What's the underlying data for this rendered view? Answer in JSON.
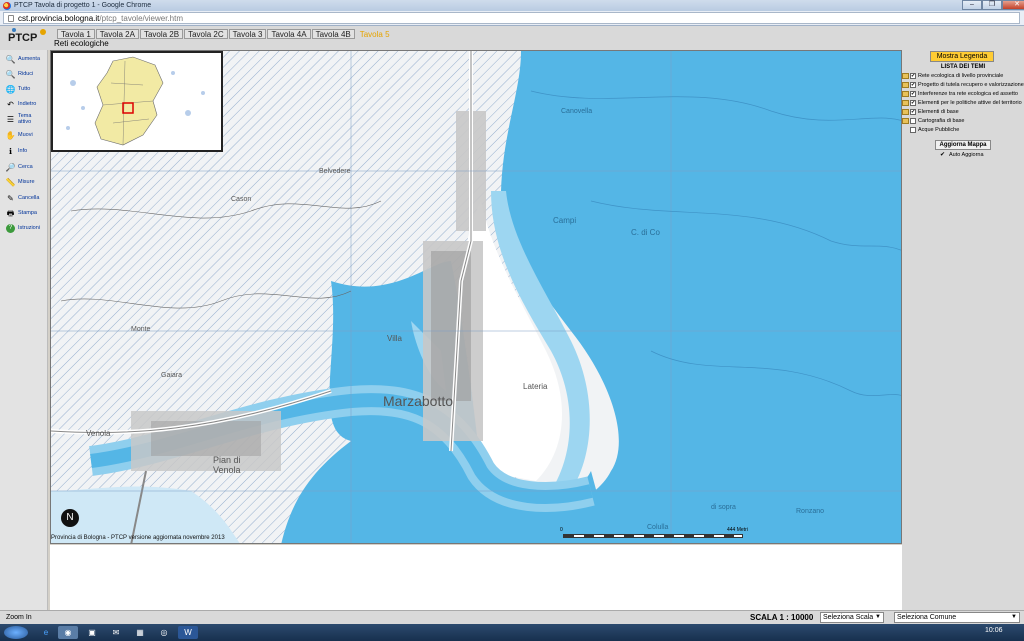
{
  "window": {
    "title": "PTCP Tavola di progetto 1 - Google Chrome",
    "controls": [
      "–",
      "❐",
      "✕"
    ]
  },
  "address": {
    "host": "cst.provincia.bologna.it",
    "path": "/ptcp_tavole/viewer.htm"
  },
  "app": {
    "logo_text": "PTCP",
    "tabs": [
      {
        "label": "Tavola 1"
      },
      {
        "label": "Tavola 2A"
      },
      {
        "label": "Tavola 2B"
      },
      {
        "label": "Tavola 2C"
      },
      {
        "label": "Tavola 3"
      },
      {
        "label": "Tavola 4A"
      },
      {
        "label": "Tavola 4B"
      },
      {
        "label": "Tavola 5"
      }
    ],
    "active_tab": "Tavola 5",
    "map_title": "Reti ecologiche"
  },
  "toolbar": {
    "items": [
      {
        "label": "Aumenta",
        "icon": "zoom-in-icon",
        "glyph": "🔍"
      },
      {
        "label": "Riduci",
        "icon": "zoom-out-icon",
        "glyph": "🔍"
      },
      {
        "label": "Tutto",
        "icon": "full-extent-icon",
        "glyph": "🌐"
      },
      {
        "label": "Indietro",
        "icon": "back-icon",
        "glyph": "↶"
      },
      {
        "label": "Tema attivo",
        "icon": "active-theme-icon",
        "glyph": "☰"
      },
      {
        "label": "Muovi",
        "icon": "pan-hand-icon",
        "glyph": "✋"
      },
      {
        "label": "Info",
        "icon": "info-icon",
        "glyph": "ℹ"
      },
      {
        "label": "Cerca",
        "icon": "search-icon",
        "glyph": "🔎"
      },
      {
        "label": "Misure",
        "icon": "ruler-icon",
        "glyph": "📏"
      },
      {
        "label": "Cancella",
        "icon": "eraser-icon",
        "glyph": "✎"
      },
      {
        "label": "Stampa",
        "icon": "print-icon",
        "glyph": "🖶"
      },
      {
        "label": "Istruzioni",
        "icon": "help-icon",
        "glyph": "?"
      }
    ]
  },
  "map": {
    "place_labels": [
      {
        "text": "Marzabotto"
      },
      {
        "text": "Pian di"
      },
      {
        "text": "Venola"
      },
      {
        "text": "Lateria"
      },
      {
        "text": "Villa"
      },
      {
        "text": "Canovella"
      },
      {
        "text": "Campi"
      },
      {
        "text": "C. di Co"
      },
      {
        "text": "Belvedere"
      },
      {
        "text": "Cason"
      },
      {
        "text": "Monte"
      },
      {
        "text": "Gaiara"
      },
      {
        "text": "Venola"
      },
      {
        "text": "Colulla"
      },
      {
        "text": "Ronzano"
      },
      {
        "text": "di sopra"
      }
    ],
    "credits": "Provincia di Bologna - PTCP versione aggiornata novembre 2013",
    "scale_start": "0",
    "scale_end": "444 Metri",
    "north_label": "N",
    "colors": {
      "water": "#54b6e6",
      "water_light": "#9dd6f1",
      "hatch": "#7d9dc4",
      "urban": "#8a8a8a"
    }
  },
  "legend": {
    "button_label": "Mostra Legenda",
    "header": "LISTA DEI TEMI",
    "layers": [
      {
        "label": "Rete ecologica di livello provinciale",
        "checked": true
      },
      {
        "label": "Progetto di tutela recupero e valorizzazione",
        "checked": true
      },
      {
        "label": "Interferenze tra rete ecologica ed assetto",
        "checked": true
      },
      {
        "label": "Elementi per le politiche attive del territorio",
        "checked": true
      },
      {
        "label": "Elementi di base",
        "checked": true
      },
      {
        "label": "Cartografia di base",
        "checked": false
      },
      {
        "label": "Acque Pubbliche",
        "checked": false
      }
    ],
    "update_button": "Aggiorna Mappa",
    "auto_update_label": "Auto Aggiorna",
    "auto_update_checked": true
  },
  "status": {
    "text": "Zoom In",
    "scale_label": "SCALA 1 : 10000",
    "select_scale": "Seleziona Scala",
    "select_comune": "Seleziona Comune"
  },
  "taskbar": {
    "clock": "10:06"
  }
}
